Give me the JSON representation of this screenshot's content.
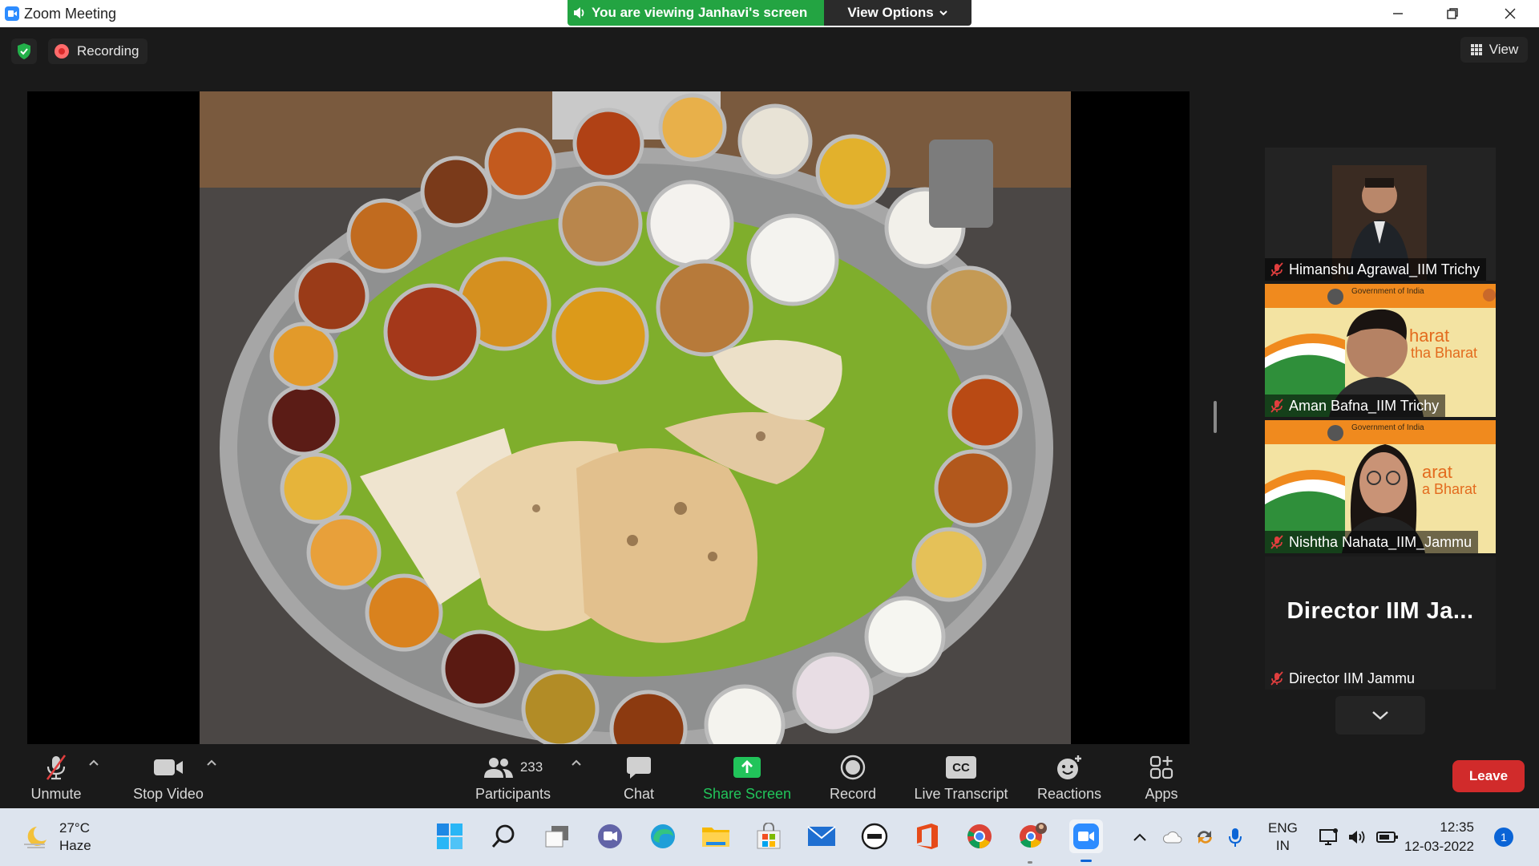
{
  "window": {
    "title": "Zoom Meeting",
    "banner": "You are viewing Janhavi's screen",
    "view_options": "View Options",
    "controls": [
      "minimize",
      "maximize",
      "close"
    ]
  },
  "topbar": {
    "recording_label": "Recording",
    "view_label": "View"
  },
  "gallery": {
    "tiles": [
      {
        "name": "Himanshu Agrawal_IIM Trichy",
        "muted": true,
        "video": true
      },
      {
        "name": "Aman Bafna_IIM Trichy",
        "muted": true,
        "video": true,
        "bg_text_1": "Government of India",
        "bg_text_2": "harat",
        "bg_text_3": "tha Bharat"
      },
      {
        "name": "Nishtha Nahata_IIM_Jammu",
        "muted": true,
        "video": true,
        "bg_text_1": "Government of India",
        "bg_text_2": "arat",
        "bg_text_3": "a Bharat"
      },
      {
        "name": "Director IIM Jammu",
        "muted": true,
        "video": false,
        "display_name": "Director  IIM  Ja..."
      }
    ]
  },
  "toolbar": {
    "unmute": "Unmute",
    "stop_video": "Stop Video",
    "participants": "Participants",
    "participants_count": "233",
    "chat": "Chat",
    "share_screen": "Share Screen",
    "record": "Record",
    "live_transcript": "Live Transcript",
    "cc": "CC",
    "reactions": "Reactions",
    "apps": "Apps",
    "leave": "Leave"
  },
  "taskbar": {
    "temperature": "27°C",
    "weather": "Haze",
    "language_1": "ENG",
    "language_2": "IN",
    "time": "12:35",
    "date": "12-03-2022",
    "notifications": "1",
    "apps": [
      "windows-start",
      "search",
      "task-view",
      "teams-chat",
      "edge",
      "file-explorer",
      "store",
      "mail",
      "dell",
      "office",
      "chrome",
      "chrome-profile",
      "zoom"
    ]
  },
  "colors": {
    "banner_green": "#23a442",
    "share_green": "#21c45a",
    "leave_red": "#d12b2b",
    "muted_red": "#e03e3e"
  }
}
